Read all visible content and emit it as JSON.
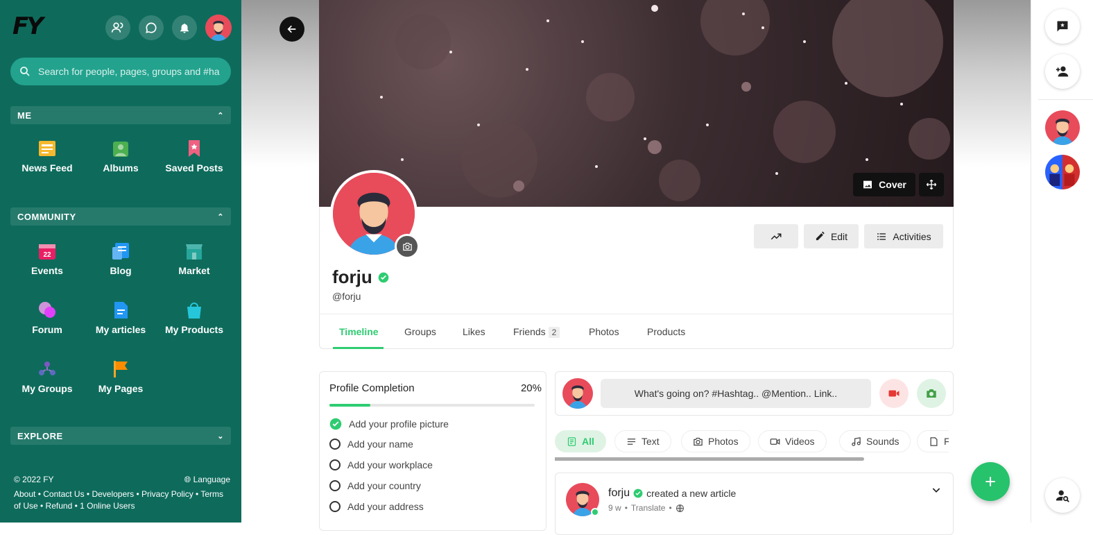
{
  "app": {
    "logo": "FY"
  },
  "search": {
    "placeholder": "Search for people, pages, groups and #ha"
  },
  "sections": {
    "me": "ME",
    "community": "COMMUNITY",
    "explore": "EXPLORE"
  },
  "me_items": [
    "News Feed",
    "Albums",
    "Saved Posts"
  ],
  "community_items": [
    "Events",
    "Blog",
    "Market",
    "Forum",
    "My articles",
    "My Products",
    "My Groups",
    "My Pages"
  ],
  "footer": {
    "copyright": "© 2022 FY",
    "language": "Language",
    "links": "About • Contact Us • Developers • Privacy Policy • Terms of Use • Refund • 1 Online Users"
  },
  "profile": {
    "name": "forju",
    "handle": "@forju",
    "cover_label": "Cover",
    "edit_label": "Edit",
    "activities_label": "Activities"
  },
  "tabs": {
    "timeline": "Timeline",
    "groups": "Groups",
    "likes": "Likes",
    "friends": "Friends",
    "friends_count": "2",
    "photos": "Photos",
    "products": "Products"
  },
  "completion": {
    "title": "Profile Completion",
    "percent": "20%",
    "progress": 0.2,
    "items": [
      "Add your profile picture",
      "Add your name",
      "Add your workplace",
      "Add your country",
      "Add your address"
    ]
  },
  "composer": {
    "placeholder": "What's going on? #Hashtag.. @Mention.. Link.."
  },
  "filters": {
    "all": "All",
    "text": "Text",
    "photos": "Photos",
    "videos": "Videos",
    "sounds": "Sounds",
    "more": "F"
  },
  "post": {
    "author": "forju",
    "action": "created a new article",
    "time": "9 w",
    "translate": "Translate"
  },
  "colors": {
    "sidebar": "#0e6b5c",
    "accent": "#2ecc71",
    "fab": "#27c26c"
  }
}
